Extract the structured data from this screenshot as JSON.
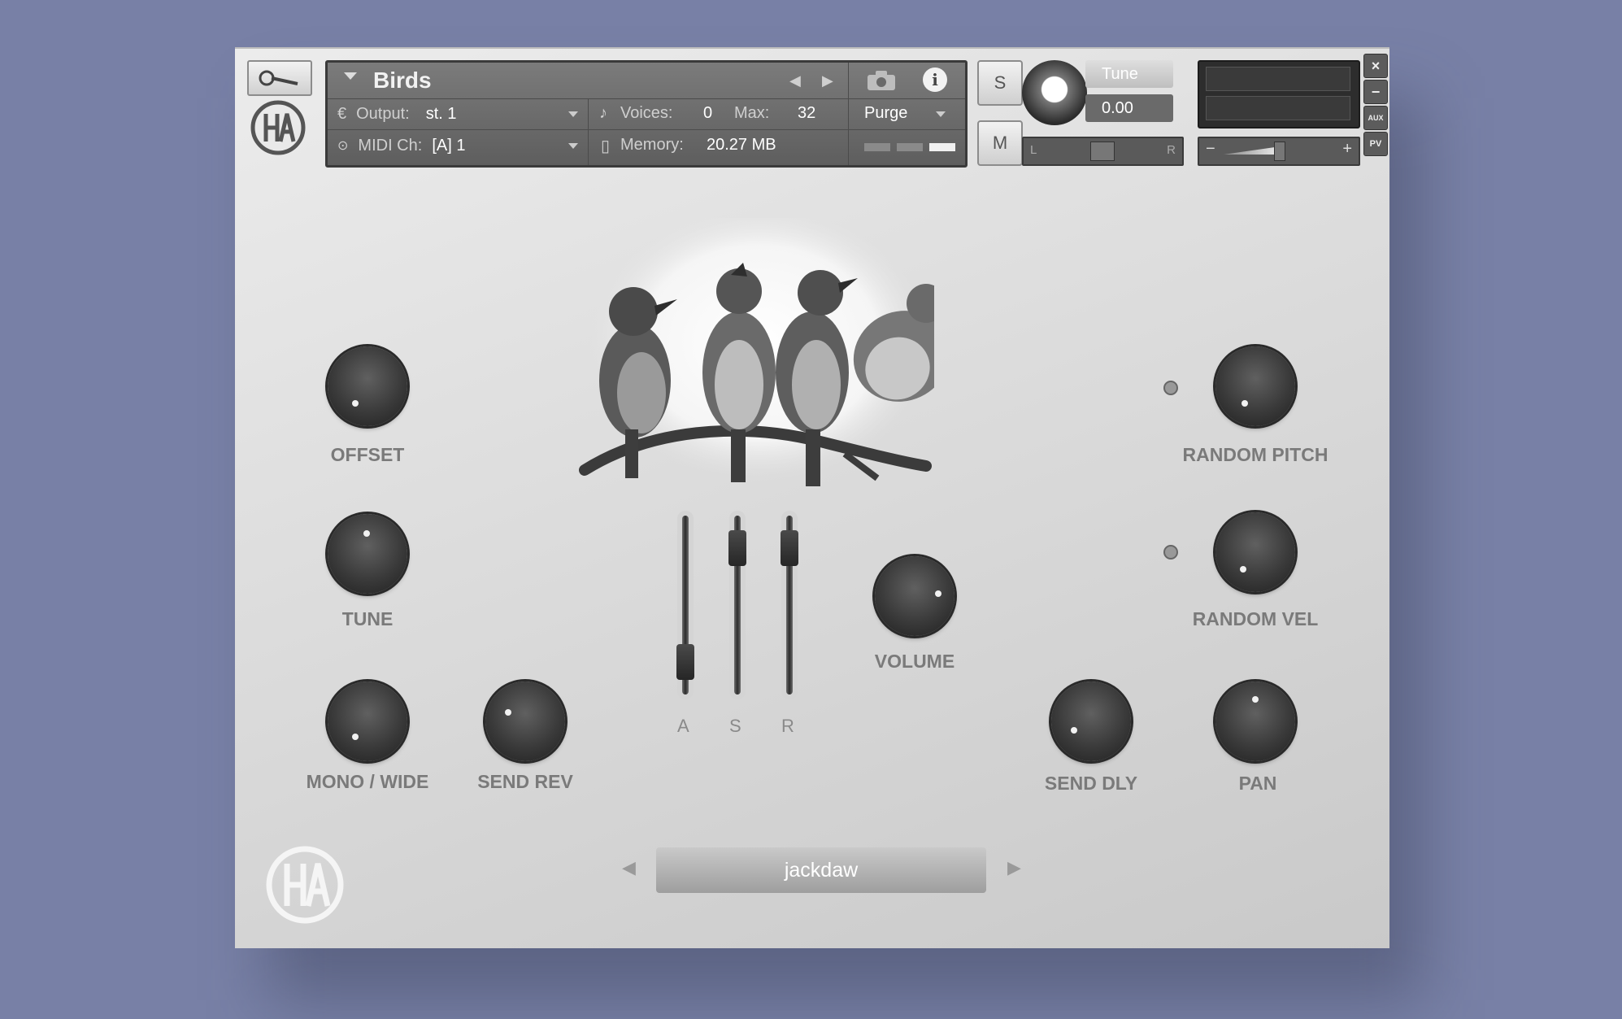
{
  "instrument": {
    "name": "Birds",
    "output_label": "Output:",
    "output_value": "st. 1",
    "midi_label": "MIDI Ch:",
    "midi_value": "[A]  1",
    "voices_label": "Voices:",
    "voices_value": "0",
    "max_label": "Max:",
    "max_value": "32",
    "memory_label": "Memory:",
    "memory_value": "20.27 MB",
    "purge_label": "Purge"
  },
  "header_controls": {
    "solo_label": "S",
    "mute_label": "M",
    "tune_label": "Tune",
    "tune_value": "0.00",
    "pan_left": "L",
    "pan_right": "R",
    "vol_minus": "−",
    "vol_plus": "+",
    "close": "×",
    "minimize": "−",
    "aux": "AUX",
    "pv": "PV"
  },
  "knobs": {
    "offset": "OFFSET",
    "tune": "TUNE",
    "mono_wide": "MONO / WIDE",
    "send_rev": "SEND REV",
    "volume": "VOLUME",
    "random_pitch": "RANDOM PITCH",
    "random_vel": "RANDOM VEL",
    "send_dly": "SEND DLY",
    "pan": "PAN"
  },
  "envelope": {
    "attack_label": "A",
    "sustain_label": "S",
    "release_label": "R",
    "attack_level": 0.1,
    "sustain_level": 0.9,
    "release_level": 0.9
  },
  "preset": {
    "name": "jackdaw",
    "prev": "◀",
    "next": "▶"
  },
  "logo_text": "HA"
}
